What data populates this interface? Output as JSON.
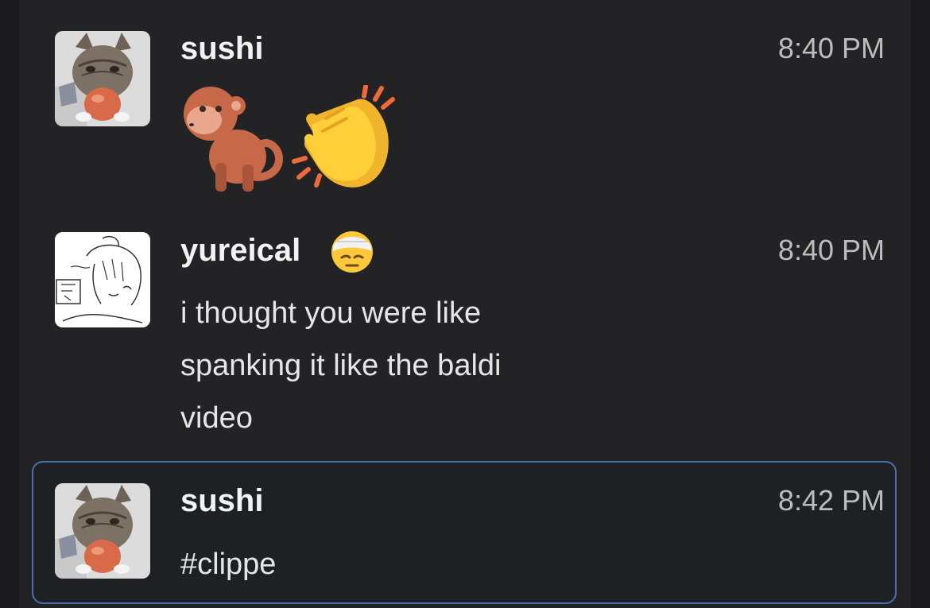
{
  "messages": [
    {
      "author": "sushi",
      "time": "8:40 PM",
      "avatar": "cat-with-apple-avatar",
      "content_type": "emoji",
      "emojis": [
        "monkey-emoji",
        "clapping-hands-emoji"
      ]
    },
    {
      "author": "yureical",
      "author_badge": "bandaged-face-emoji",
      "time": "8:40 PM",
      "avatar": "sketch-drawing-avatar",
      "lines": [
        "i thought you were like",
        "spanking it like the baldi",
        "video"
      ]
    },
    {
      "author": "sushi",
      "time": "8:42 PM",
      "avatar": "cat-with-apple-avatar",
      "text": "#clippe",
      "selected": true
    }
  ],
  "colors": {
    "background": "#1a1a1c",
    "panel": "#232325",
    "selection_border": "#4b6ea8",
    "timestamp": "#bdbdbd"
  }
}
